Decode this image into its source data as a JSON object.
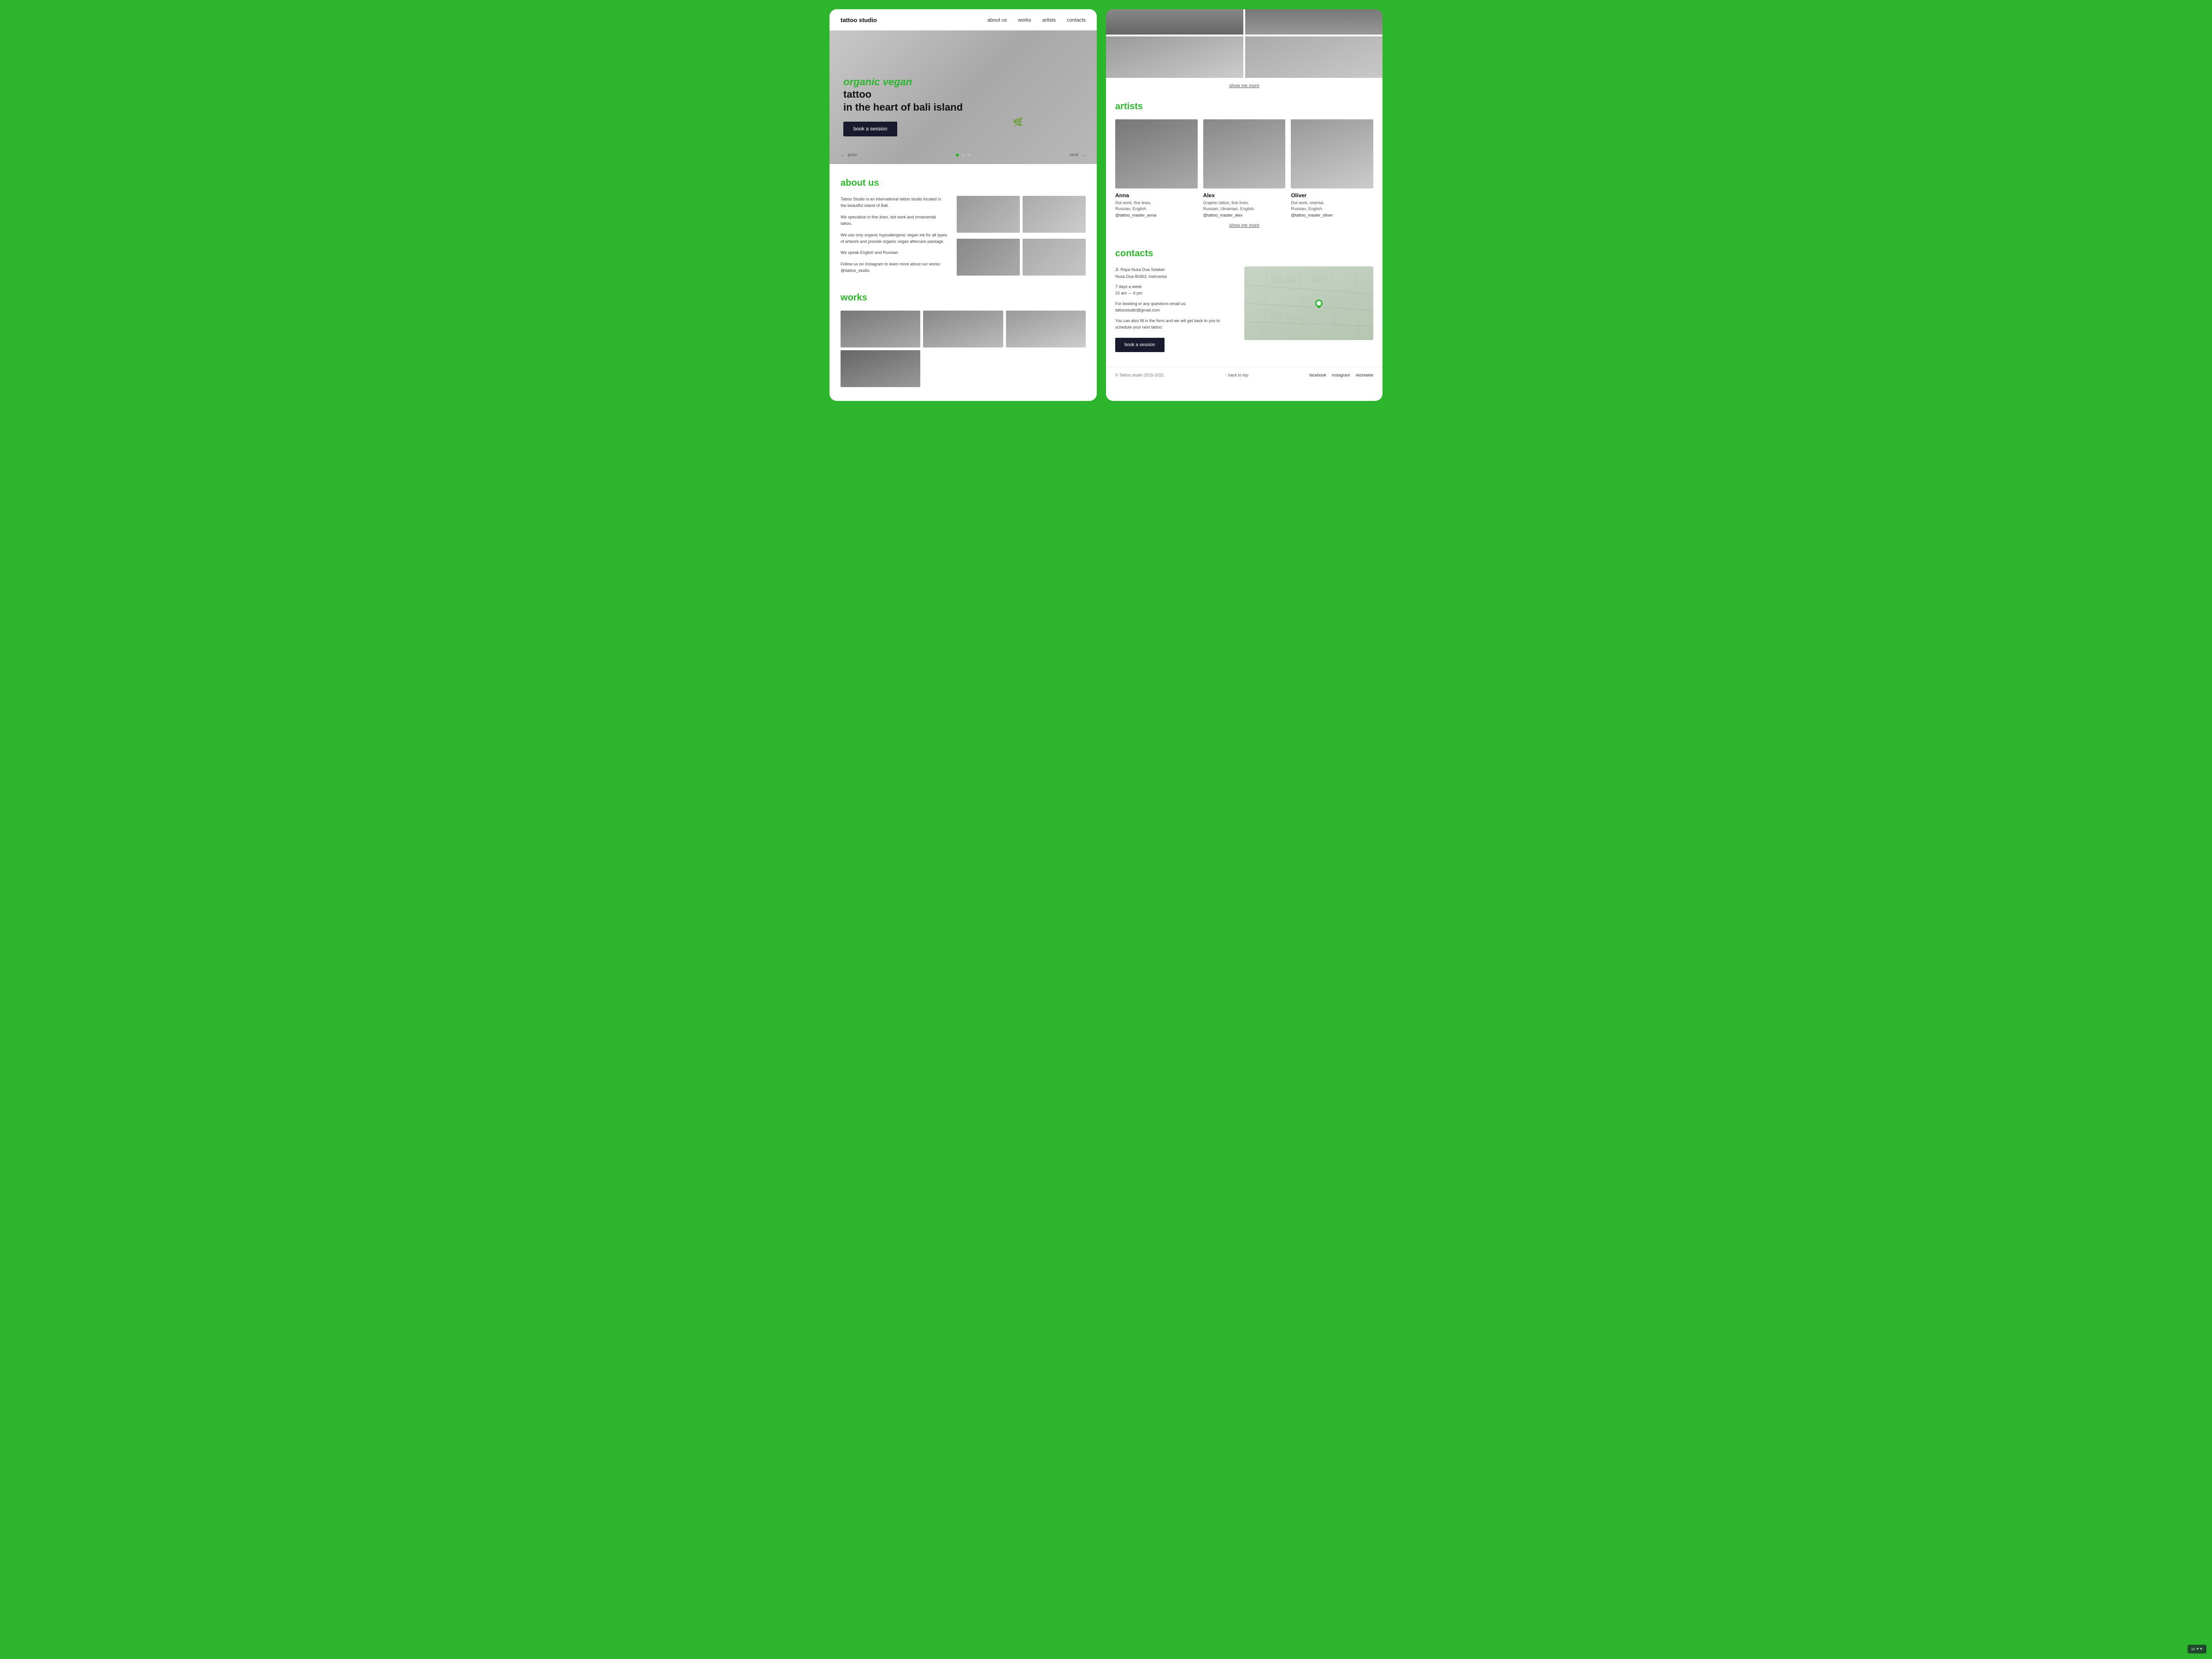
{
  "brand": {
    "name": "tattoo studio"
  },
  "navbar": {
    "links": [
      {
        "label": "about us",
        "href": "#about"
      },
      {
        "label": "works",
        "href": "#works"
      },
      {
        "label": "artists",
        "href": "#artists"
      },
      {
        "label": "contacts",
        "href": "#contacts"
      }
    ]
  },
  "hero": {
    "title_green": "organic vegan",
    "title_black": "tattoo\nin the heart of bali island",
    "cta_label": "book a session",
    "prev_label": "prev",
    "next_label": "next"
  },
  "about": {
    "section_title": "about us",
    "paragraph1": "Tattoo Studio is an international tattoo studio located in the beautiful island of Bali.",
    "paragraph2": "We specialize in fine lines, dot work and ornamental tattoo.",
    "paragraph3": "We use only organic hypoallergenic vegan ink for all types of artwork and provide organic vegan aftercare package.",
    "paragraph4": "We speak English and Russian.",
    "paragraph5": "Follow us on Instagram to learn more about our works: @itattoo_studio."
  },
  "works": {
    "section_title": "works",
    "show_more": "show me more"
  },
  "artists": {
    "section_title": "artists",
    "show_more": "show me more",
    "items": [
      {
        "name": "Anna",
        "desc": "Dot work, fine lines.",
        "languages": "Russian, English.",
        "handle": "@tattoo_master_anna"
      },
      {
        "name": "Alex",
        "desc": "Graphic tattoo, fine lines.",
        "languages": "Russian, Ukrainian, English.",
        "handle": "@tattoo_master_alex"
      },
      {
        "name": "Oliver",
        "desc": "Dot work, oriental.",
        "languages": "Russian, English.",
        "handle": "@tattoo_master_oliver"
      }
    ]
  },
  "contacts": {
    "section_title": "contacts",
    "address_line1": "Jl. Raya Nusa Dua Selatan",
    "address_line2": "Nusa Dua 80363, Indonesia",
    "hours_days": "7 days a week",
    "hours_time": "10 am — 6 pm",
    "email_label": "For booking or any questions email us:",
    "email": "tattoostudio@gmail.com",
    "form_text": "You can also fill in the form and we will get back to you to schedule your next tattoo:",
    "cta_label": "book a session"
  },
  "footer": {
    "copyright": "© Tattoo studio 2015-2021",
    "back_to_top": "↑ back to top",
    "social_links": [
      {
        "label": "facebook"
      },
      {
        "label": "instagram"
      },
      {
        "label": "vkontakte"
      }
    ]
  },
  "ui_badge": "ui ✦✦"
}
